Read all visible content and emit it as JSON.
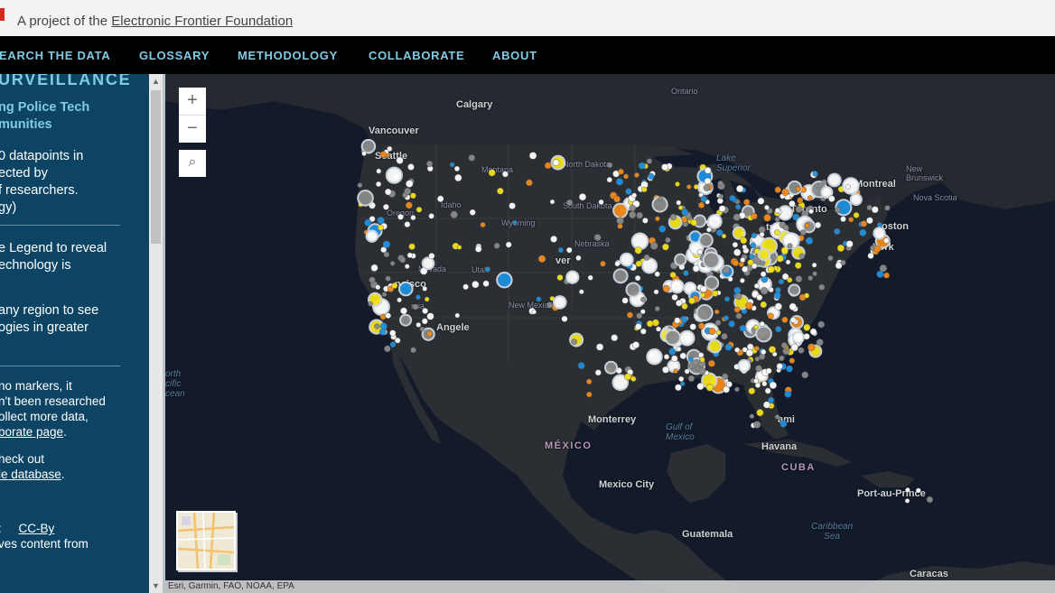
{
  "banner": {
    "prefix": "A project of the",
    "org_link": "Electronic Frontier Foundation"
  },
  "nav": {
    "items": [
      "EARCH THE DATA",
      "GLOSSARY",
      "METHODOLOGY",
      "COLLABORATE",
      "ABOUT"
    ]
  },
  "sidebar": {
    "title": "URVEILLANCE",
    "subtitle_1": "ng Police Tech",
    "subtitle_2": "munities",
    "p1_1": "0 datapoints in",
    "p1_2": "ected by",
    "p1_3": "f researchers.",
    "p1_4": "gy)",
    "p2_1": "e Legend to reveal",
    "p2_2": "echnology is",
    "p3_1": "any region to see",
    "p3_2": "ogies in greater",
    "p4_1": " no markers, it",
    "p4_2": "n't been researched",
    "p4_3": "ollect more data,",
    "p4_4_link": "borate page",
    "p4_4_tail": ".",
    "p5_1": "heck out",
    "p5_2_link": "le database",
    "p5_2_tail": ".",
    "lic_1": ":",
    "lic_link": "CC-By",
    "lic_2": "ves content from"
  },
  "map": {
    "zoom_in": "+",
    "zoom_out": "−",
    "search": "⌕",
    "attribution": "Esri, Garmin, FAO, NOAA, EPA",
    "labels": {
      "ontario": "Ontario",
      "calgary": "Calgary",
      "vancouver": "Vancouver",
      "seattle": "Seattle",
      "montana": "Montana",
      "north_dakota": "North Dakota",
      "lake_superior_1": "Lake",
      "lake_superior_2": "Superior",
      "quebec_nb_1": "New",
      "quebec_nb_2": "Brunswick",
      "nova_scotia": "Nova Scotia",
      "montreal": "Montreal",
      "toronto": "Toronto",
      "oregon": "Oregon",
      "idaho": "Idaho",
      "south_dakota": "South Dakota",
      "wyoming": "Wyoming",
      "nebraska": "Nebraska",
      "detroit": "troit",
      "boston": "oston",
      "new_york": "York",
      "nevada": "Nevada",
      "utah": "Utah",
      "denver": "ver",
      "san_francisco": "ncisco",
      "california": "rnia",
      "los_angeles": "Angele",
      "new_mexico": "New Mexico",
      "north_pacific_1": "orth",
      "north_pacific_2": "cific",
      "north_pacific_3": "cean",
      "monterrey": "Monterrey",
      "gulf_1": "Gulf of",
      "gulf_2": "Mexico",
      "mexico": "MÉXICO",
      "miami": "ami",
      "havana": "Havana",
      "cuba": "CUBA",
      "mexico_city": "Mexico City",
      "port_au_prince": "Port-au-Prince",
      "caribbean_1": "Caribbean",
      "caribbean_2": "Sea",
      "guatemala": "Guatemala",
      "caracas": "Caracas"
    }
  },
  "colors": {
    "blue_marker": "#1e90e0",
    "orange_marker": "#f08a1a",
    "yellow_marker": "#f2e21a",
    "white_marker": "#ffffff",
    "gray_marker": "#8a8a8a",
    "sidebar_bg": "#0d4464",
    "accent": "#7fcbe6"
  }
}
